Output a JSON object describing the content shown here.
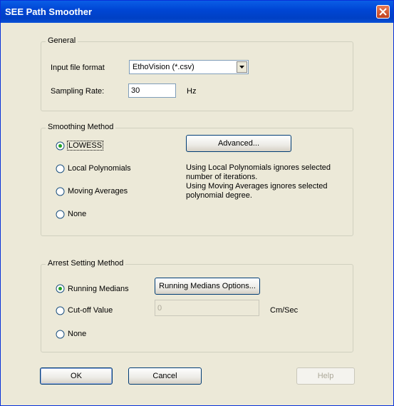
{
  "window": {
    "title": "SEE Path Smoother"
  },
  "general": {
    "title": "General",
    "input_file_format_label": "Input file format",
    "input_file_format_value": "EthoVision (*.csv)",
    "sampling_rate_label": "Sampling Rate:",
    "sampling_rate_value": "30",
    "sampling_rate_unit": "Hz"
  },
  "smoothing": {
    "title": "Smoothing Method",
    "options": [
      "LOWESS",
      "Local Polynomials",
      "Moving Averages",
      "None"
    ],
    "selected": "LOWESS",
    "advanced_label": "Advanced...",
    "note": "Using Local Polynomials ignores selected\nnumber of iterations.\nUsing Moving Averages ignores selected\npolynomial degree."
  },
  "arrest": {
    "title": "Arrest Setting Method",
    "options": [
      "Running Medians",
      "Cut-off Value",
      "None"
    ],
    "selected": "Running Medians",
    "running_medians_options_label": "Running Medians Options...",
    "cutoff_value": "0",
    "cutoff_unit": "Cm/Sec"
  },
  "footer": {
    "ok": "OK",
    "cancel": "Cancel",
    "help": "Help"
  },
  "colors": {
    "titlebar": "#0046d5",
    "face": "#ece9d8",
    "accent": "#003c74"
  },
  "icons": {
    "close": "close-icon",
    "dropdown": "chevron-down-icon"
  }
}
